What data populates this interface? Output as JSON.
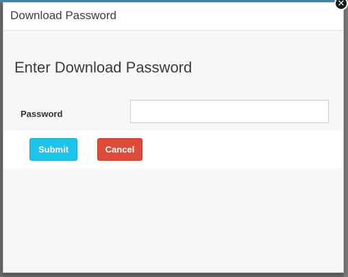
{
  "dialog": {
    "title": "Download Password",
    "close_glyph": "✕",
    "heading": "Enter Download Password",
    "password_label": "Password",
    "password_value": "",
    "password_placeholder": "",
    "submit_label": "Submit",
    "cancel_label": "Cancel"
  },
  "colors": {
    "submit_button": "#1cc3ec",
    "cancel_button": "#dd4b39",
    "backdrop": "#6b6b6b"
  }
}
